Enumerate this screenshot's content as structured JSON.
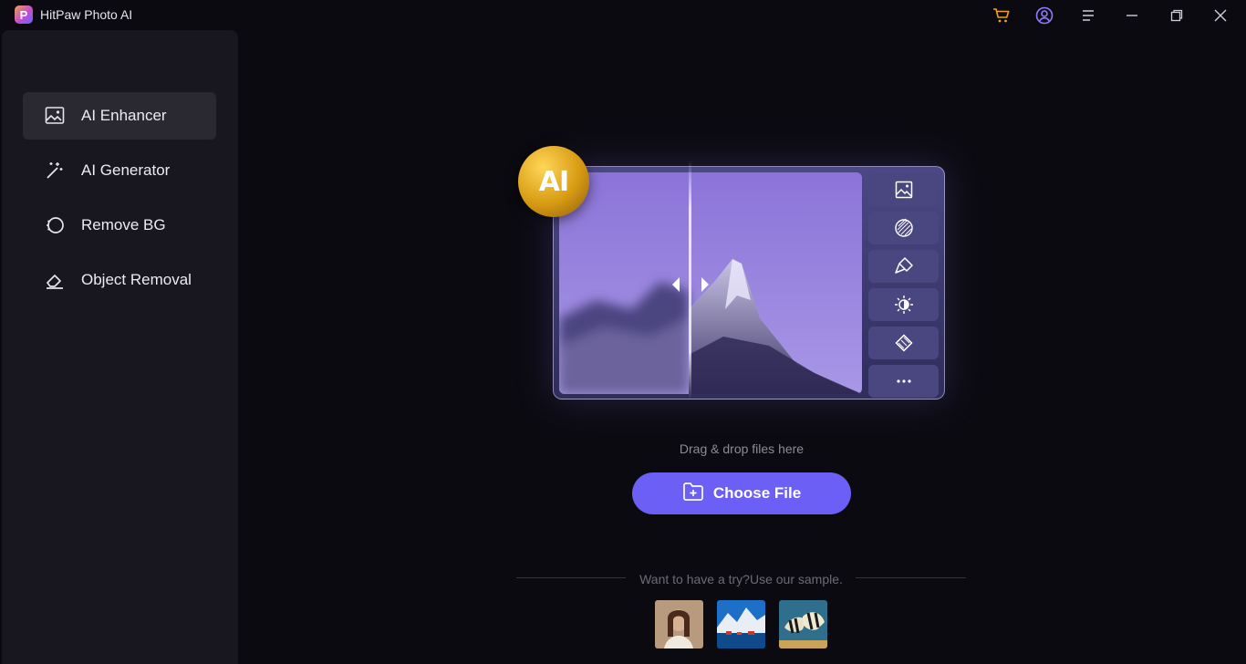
{
  "app": {
    "title": "HitPaw Photo AI",
    "logo_letter": "P"
  },
  "titlebar_icons": [
    "cart-icon",
    "account-icon",
    "menu-icon",
    "minimize-icon",
    "restore-icon",
    "close-icon"
  ],
  "sidebar": {
    "items": [
      {
        "label": "AI Enhancer",
        "icon": "image-enhance-icon",
        "active": true
      },
      {
        "label": "AI Generator",
        "icon": "magic-wand-icon",
        "active": false
      },
      {
        "label": "Remove BG",
        "icon": "remove-bg-icon",
        "active": false
      },
      {
        "label": "Object Removal",
        "icon": "eraser-icon",
        "active": false
      }
    ]
  },
  "hero": {
    "badge": "AI",
    "tools": [
      "image-icon",
      "pattern-icon",
      "brush-icon",
      "brightness-icon",
      "crop-icon",
      "more-icon"
    ]
  },
  "upload": {
    "drop_text": "Drag & drop files here",
    "choose_label": "Choose File"
  },
  "samples": {
    "text": "Want to have a try?Use our sample.",
    "items": [
      "portrait-sample",
      "landscape-sample",
      "fish-sample"
    ]
  },
  "colors": {
    "accent": "#6b5ff5",
    "badge": "#d79a12",
    "cart": "#f0a020",
    "account": "#8f7bff"
  }
}
